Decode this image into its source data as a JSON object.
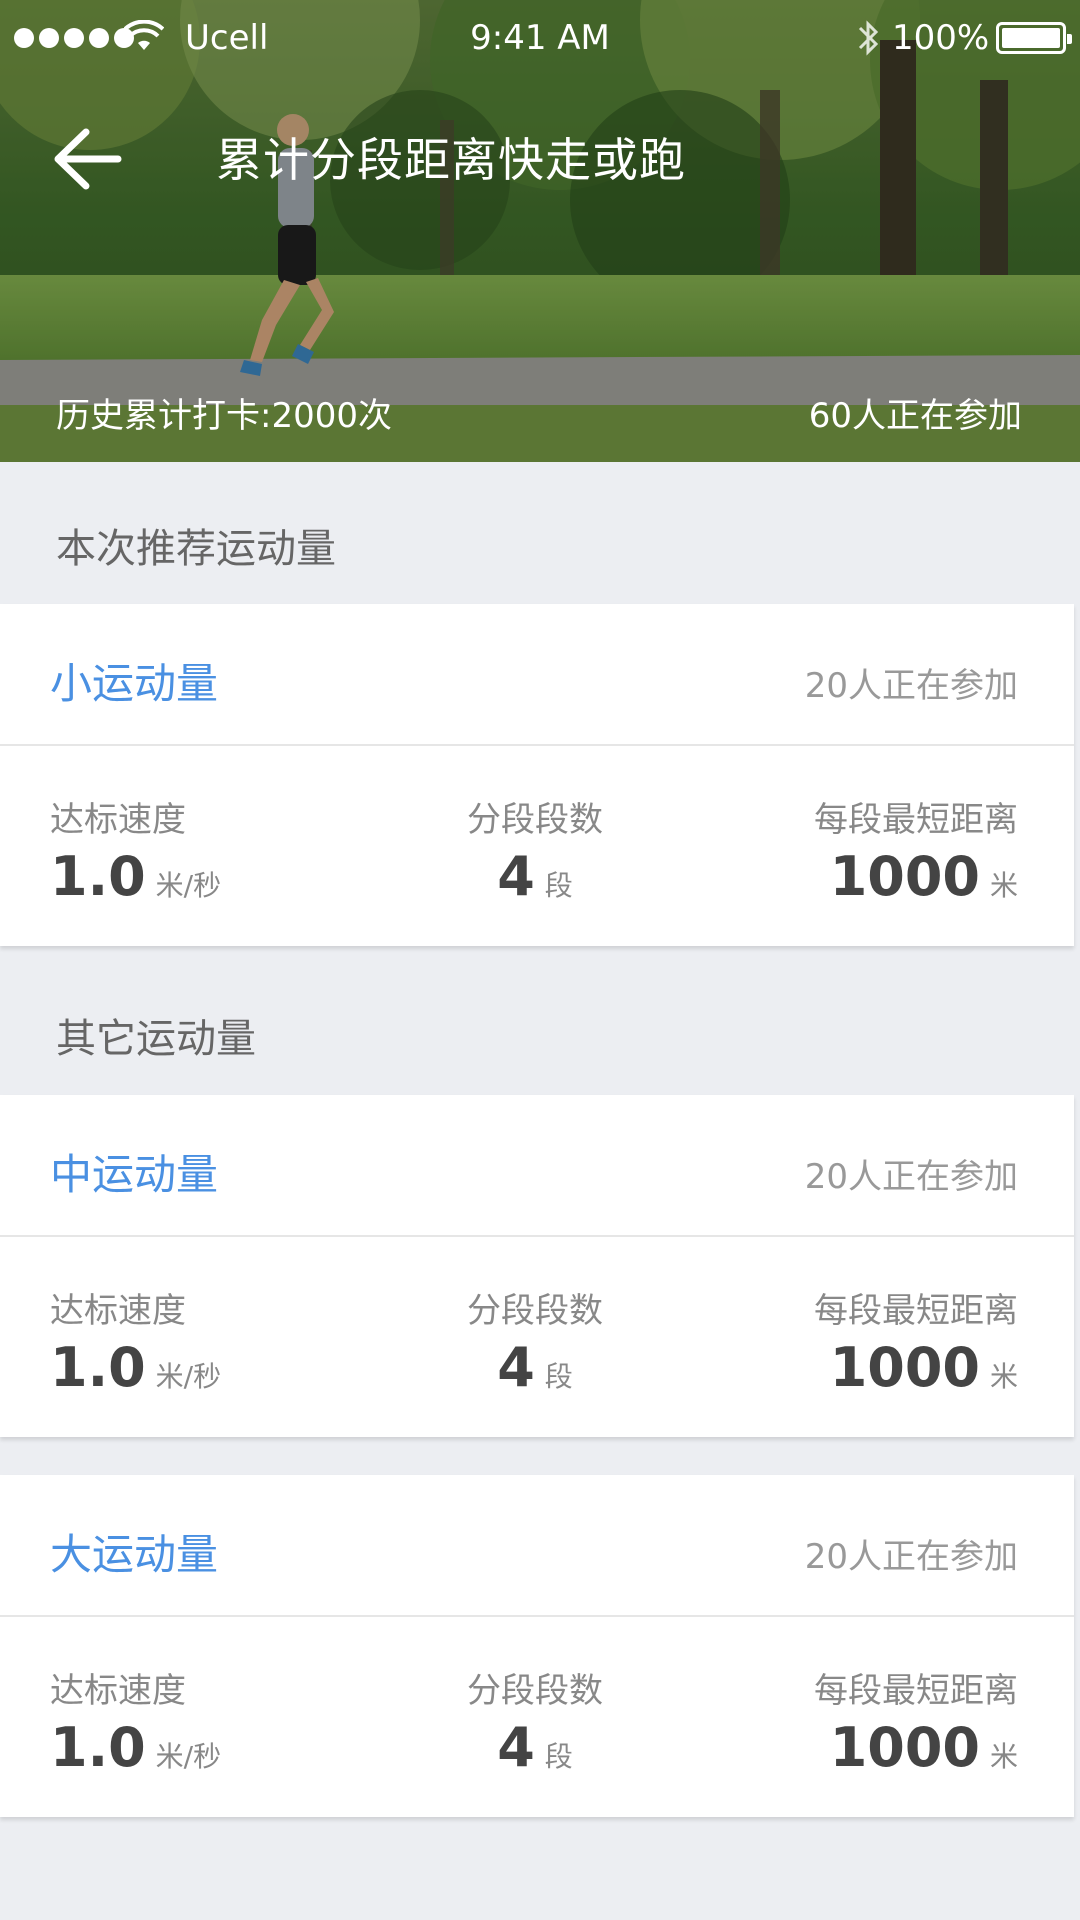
{
  "status_bar": {
    "carrier": "Ucell",
    "time": "9:41 AM",
    "battery": "100%"
  },
  "header": {
    "title": "累计分段距离快走或跑",
    "history": "历史累计打卡:2000次",
    "participants": "60人正在参加"
  },
  "recommended": {
    "label": "本次推荐运动量",
    "card": {
      "name": "小运动量",
      "participants": "20人正在参加",
      "stats": [
        {
          "label": "达标速度",
          "value": "1.0",
          "unit": "米/秒"
        },
        {
          "label": "分段段数",
          "value": "4",
          "unit": "段"
        },
        {
          "label": "每段最短距离",
          "value": "1000",
          "unit": "米"
        }
      ]
    }
  },
  "others": {
    "label": "其它运动量",
    "cards": [
      {
        "name": "中运动量",
        "participants": "20人正在参加",
        "stats": [
          {
            "label": "达标速度",
            "value": "1.0",
            "unit": "米/秒"
          },
          {
            "label": "分段段数",
            "value": "4",
            "unit": "段"
          },
          {
            "label": "每段最短距离",
            "value": "1000",
            "unit": "米"
          }
        ]
      },
      {
        "name": "大运动量",
        "participants": "20人正在参加",
        "stats": [
          {
            "label": "达标速度",
            "value": "1.0",
            "unit": "米/秒"
          },
          {
            "label": "分段段数",
            "value": "4",
            "unit": "段"
          },
          {
            "label": "每段最短距离",
            "value": "1000",
            "unit": "米"
          }
        ]
      }
    ]
  },
  "colors": {
    "accent": "#4a90e2",
    "page_bg": "#eceef2"
  }
}
